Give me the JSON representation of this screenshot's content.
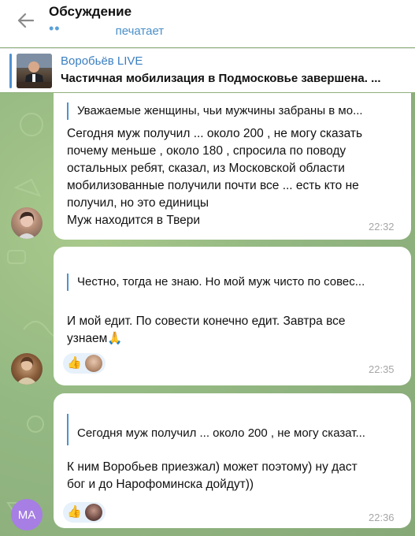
{
  "header": {
    "title": "Обсуждение",
    "typing_dots": "••",
    "typing_text": "печатает"
  },
  "pinned": {
    "channel": "Воробьёв LIVE",
    "text": "Частичная мобилизация в Подмосковье завершена. ..."
  },
  "messages": [
    {
      "reply": "Уважаемые женщины, чьи мужчины забраны в мо...",
      "lines": [
        "Сегодня муж получил ... около 200 , не могу сказать",
        "почему меньше , около 180 , спросила по поводу",
        "остальных ребят, сказал, из Московской области",
        "мобилизованные получили почти все ... есть кто не",
        "получил, но это единицы",
        "Муж находится в Твери"
      ],
      "time": "22:32"
    },
    {
      "reply": "Честно, тогда не знаю. Но мой муж чисто по совес...",
      "lines": [
        "И мой едит. По совести конечно едит. Завтра все",
        "узнаем🙏"
      ],
      "reaction": "👍",
      "time": "22:35"
    },
    {
      "reply": "Сегодня муж получил ... около 200 , не могу сказат...",
      "lines": [
        "К ним Воробьев приезжал) может поэтому) ну даст",
        "бог и до Нарофоминска дойдут))"
      ],
      "reaction": "👍",
      "avatar_initials": "MA",
      "time": "22:36"
    }
  ],
  "colors": {
    "accent": "#4e92cf",
    "chat_bg": "#95b983",
    "avatar_ma": "#a77ee4"
  }
}
